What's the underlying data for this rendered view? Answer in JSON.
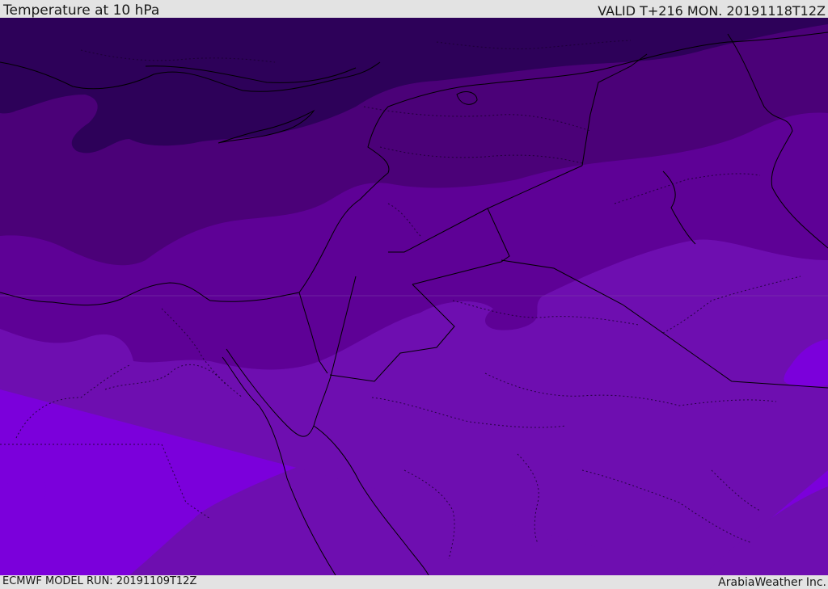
{
  "header": {
    "title": "Temperature at 10 hPa",
    "valid": "VALID T+216 MON. 20191118T12Z"
  },
  "footer": {
    "model_run": "ECMWF MODEL RUN: 20191109T12Z",
    "brand": "ArabiaWeather Inc."
  },
  "colors": {
    "band_coldest": "#2d0159",
    "band_2": "#4b0178",
    "band_3": "#5e0196",
    "band_4": "#6e0eb0",
    "band_warmest": "#7b00db",
    "coastline": "#000000",
    "border": "#000000"
  }
}
